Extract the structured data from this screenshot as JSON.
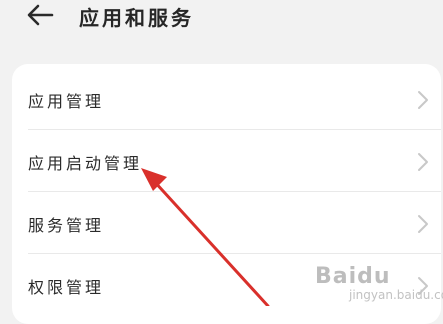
{
  "header": {
    "title": "应用和服务",
    "back_icon": "arrow-left-icon"
  },
  "list": {
    "items": [
      {
        "label": "应用管理"
      },
      {
        "label": "应用启动管理"
      },
      {
        "label": "服务管理"
      },
      {
        "label": "权限管理"
      }
    ],
    "chevron_icon": "chevron-right-icon"
  },
  "annotation": {
    "arrow_color": "#d9302b"
  },
  "watermark": {
    "logo_text": "Baidu",
    "sub_text": "jingyan.baidu.com"
  }
}
